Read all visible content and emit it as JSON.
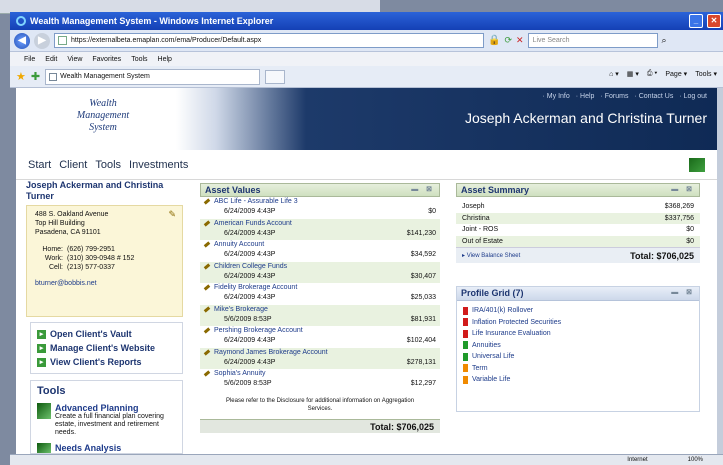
{
  "browser": {
    "title": "Wealth Management System - Windows Internet Explorer",
    "url": "https://externalbeta.emaplan.com/ema/Producer/Default.aspx",
    "search_placeholder": "Live Search",
    "menu": [
      "File",
      "Edit",
      "View",
      "Favorites",
      "Tools",
      "Help"
    ],
    "tab_title": "Wealth Management System",
    "commands": [
      "Page ▾",
      "Tools ▾"
    ],
    "status_zone": "Internet",
    "status_zoom": "100%"
  },
  "app": {
    "logo_lines": [
      "Wealth",
      "Management",
      "System"
    ],
    "top_links": [
      "· My Info",
      "· Help",
      "· Forums",
      "· Contact Us",
      "· Log out"
    ],
    "client_header": "Joseph Ackerman and Christina Turner",
    "nav": [
      "Start",
      "Client",
      "Tools",
      "Investments"
    ]
  },
  "client": {
    "name": "Joseph Ackerman and Christina Turner",
    "address": [
      "488 S. Oakland Avenue",
      "Top Hill Building",
      "Pasadena, CA 91101"
    ],
    "phones": [
      {
        "label": "Home:",
        "value": "(626) 799-2951"
      },
      {
        "label": "Work:",
        "value": "(310) 309-0948 # 152"
      },
      {
        "label": "Cell:",
        "value": "(213) 577-0337"
      }
    ],
    "email": "bturner@bobbis.net",
    "actions": [
      "Open Client's Vault",
      "Manage Client's Website",
      "View Client's Reports"
    ]
  },
  "tools": {
    "title": "Tools",
    "items": [
      {
        "title": "Advanced Planning",
        "desc": "Create a full financial plan covering estate, investment and retirement needs."
      },
      {
        "title": "Needs Analysis",
        "desc": ""
      }
    ]
  },
  "asset_values": {
    "title": "Asset Values",
    "rows": [
      {
        "name": "ABC Life - Assurable Life 3",
        "date": "6/24/2009 4:43P",
        "value": "$0"
      },
      {
        "name": "American Funds Account",
        "date": "6/24/2009 4:43P",
        "value": "$141,230"
      },
      {
        "name": "Annuity Account",
        "date": "6/24/2009 4:43P",
        "value": "$34,592"
      },
      {
        "name": "Children College Funds",
        "date": "6/24/2009 4:43P",
        "value": "$30,407"
      },
      {
        "name": "Fidelity Brokerage Account",
        "date": "6/24/2009 4:43P",
        "value": "$25,033"
      },
      {
        "name": "Mike's Brokerage",
        "date": "5/6/2009 8:53P",
        "value": "$81,931"
      },
      {
        "name": "Pershing Brokerage Account",
        "date": "6/24/2009 4:43P",
        "value": "$102,404"
      },
      {
        "name": "Raymond James Brokerage Account",
        "date": "6/24/2009 4:43P",
        "value": "$278,131"
      },
      {
        "name": "Sophia's Annuity",
        "date": "5/6/2009 8:53P",
        "value": "$12,297"
      }
    ],
    "note": "Please refer to the Disclosure for additional information on Aggregation Services.",
    "total": "Total: $706,025"
  },
  "asset_summary": {
    "title": "Asset Summary",
    "rows": [
      {
        "label": "Joseph",
        "value": "$368,269"
      },
      {
        "label": "Christina",
        "value": "$337,756"
      },
      {
        "label": "Joint - ROS",
        "value": "$0"
      },
      {
        "label": "Out of Estate",
        "value": "$0"
      }
    ],
    "link": "View Balance Sheet",
    "total": "Total: $706,025"
  },
  "profile_grid": {
    "title": "Profile Grid (7)",
    "items": [
      {
        "label": "IRA/401(k) Rollover",
        "color": "#d11b1b"
      },
      {
        "label": "Inflation Protected Securities",
        "color": "#d11b1b"
      },
      {
        "label": "Life Insurance Evaluation",
        "color": "#d11b1b"
      },
      {
        "label": "Annuities",
        "color": "#1f9a2a"
      },
      {
        "label": "Universal Life",
        "color": "#1f9a2a"
      },
      {
        "label": "Term",
        "color": "#f08a00"
      },
      {
        "label": "Variable Life",
        "color": "#f08a00"
      }
    ]
  }
}
